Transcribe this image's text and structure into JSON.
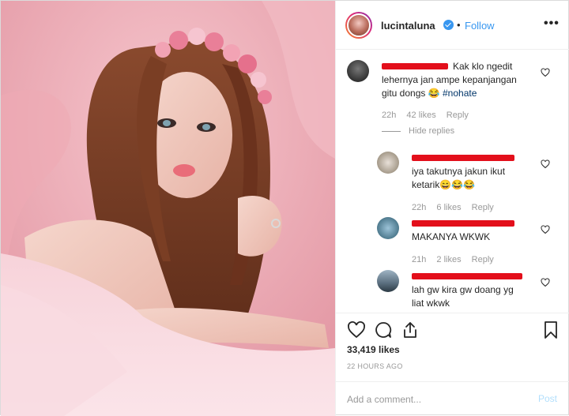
{
  "header": {
    "username": "lucintaluna",
    "separator": "•",
    "follow_label": "Follow",
    "more_label": "•••"
  },
  "comments": [
    {
      "text_lines": [
        "Kak klo ngedit",
        "lehernya jan ampe kepanjangan",
        "gitu dongs 😂 "
      ],
      "hashtag": "#nohate",
      "time": "22h",
      "likes": "42 likes",
      "reply_label": "Reply",
      "hide_replies_label": "Hide replies"
    },
    {
      "text_lines": [
        "iya takutnya jakun ikut",
        "ketarik😄😂😂"
      ],
      "time": "22h",
      "likes": "6 likes",
      "reply_label": "Reply"
    },
    {
      "text_lines": [
        "MAKANYA WKWK"
      ],
      "time": "21h",
      "likes": "2 likes",
      "reply_label": "Reply"
    },
    {
      "text_lines": [
        "lah gw kira gw doang yg",
        "liat wkwk"
      ]
    }
  ],
  "actions": {
    "likes_count": "33,419 likes",
    "timestamp": "22 HOURS AGO"
  },
  "add_comment": {
    "placeholder": "Add a comment...",
    "post_label": "Post"
  },
  "colors": {
    "accent": "#3897f0",
    "redaction": "#e30f1b",
    "muted": "#999999"
  }
}
